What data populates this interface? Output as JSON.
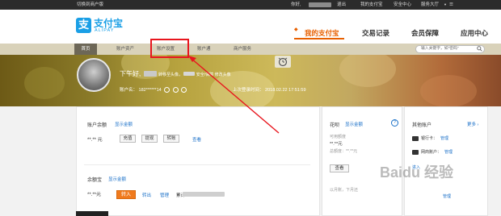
{
  "topbar": {
    "switch_label": "切换到商户版",
    "hello": "你好,",
    "logout": "退出",
    "my_alipay": "我的支付宝",
    "security_center": "安全中心",
    "service_hall": "服务大厅"
  },
  "brand": {
    "mark": "支",
    "name_cn": "支付宝",
    "name_en": "ALIPAY"
  },
  "main_nav": [
    "我的支付宝",
    "交易记录",
    "会员保障",
    "应用中心"
  ],
  "sub_nav": [
    "首页",
    "账户资产",
    "账户设置",
    "账户通",
    "商户服务"
  ],
  "search": {
    "placeholder": "输入关键字，如\"密码\""
  },
  "profile": {
    "greeting": "下午好,",
    "avatar_link": "转移至头像，",
    "security_text": "安全/保障",
    "edit_avatar": "修改头像",
    "account_label": "账户名：",
    "account_number": "182******14",
    "last_login_label": "上次登录时间：",
    "last_login_time": "2018.02.22 17:51:59"
  },
  "balance": {
    "title": "账户余额",
    "show_amount": "显示金额",
    "amount": "**.** 元",
    "buttons": [
      "充值",
      "提现",
      "转账"
    ],
    "view": "查看"
  },
  "yuebao": {
    "title": "余额宝",
    "show_amount": "显示金额",
    "amount": "**.**元",
    "transfer_in": "转入",
    "transfer_out": "转出",
    "manage": "管理",
    "extra": "累计"
  },
  "huabei": {
    "title": "花呗",
    "show_amount": "显示金额",
    "help": "?",
    "available_label": "可用额度",
    "available": "**.**元",
    "total_label": "总额度：",
    "total": "**.**元",
    "view": "查看",
    "bill_text": "以月账，下月还"
  },
  "other_accounts": {
    "title": "其他账户",
    "more": "更多",
    "items": [
      {
        "label": "银行卡：",
        "action": "管理"
      },
      {
        "label": "网商账户：",
        "action": "管理"
      },
      {
        "label": "进入",
        "action": ""
      },
      {
        "label": "",
        "action": "管理"
      }
    ]
  },
  "watermark": "Baidu 经验"
}
